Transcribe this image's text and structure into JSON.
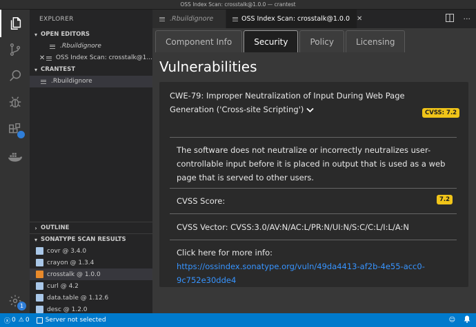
{
  "window": {
    "title": "OSS Index Scan: crosstalk@1.0.0 — crantest"
  },
  "colors": {
    "accent": "#007acc",
    "cvss_badge": "#f0c419",
    "link": "#3794ff",
    "r_package": "#a9c7e8",
    "selected_package": "#e8892b"
  },
  "activity_bar": {
    "icons": [
      "files-icon",
      "source-control-icon",
      "search-icon",
      "debug-icon",
      "extensions-icon",
      "docker-icon",
      "gear-icon"
    ],
    "extensions_badge": "",
    "settings_badge": "1"
  },
  "sidebar": {
    "title": "EXPLORER",
    "open_editors": {
      "label": "OPEN EDITORS",
      "items": [
        ".Rbuildignore",
        "OSS Index Scan: crosstalk@1..."
      ]
    },
    "folder": {
      "label": "CRANTEST",
      "items": [
        ".Rbuildignore"
      ]
    },
    "outline_label": "OUTLINE",
    "sonatype": {
      "label": "SONATYPE SCAN RESULTS",
      "packages": [
        "covr @ 3.4.0",
        "crayon @ 1.3.4",
        "crosstalk @ 1.0.0",
        "curl @ 4.2",
        "data.table @ 1.12.6",
        "desc @ 1.2.0"
      ]
    }
  },
  "editor": {
    "tabs": [
      ".Rbuildignore",
      "OSS Index Scan: crosstalk@1.0.0"
    ],
    "close_glyph": "✕",
    "subtabs": [
      "Component Info",
      "Security",
      "Policy",
      "Licensing"
    ],
    "heading": "Vulnerabilities",
    "vulnerability": {
      "title": "CWE-79: Improper Neutralization of Input During Web Page Generation ('Cross-site Scripting')",
      "badge": "CVSS: 7.2",
      "description": "The software does not neutralize or incorrectly neutralizes user-controllable input before it is placed in output that is used as a web page that is served to other users.",
      "score_label": "CVSS Score:",
      "score_value": "7.2",
      "vector": "CVSS Vector: CVSS:3.0/AV:N/AC:L/PR:N/UI:N/S:C/C:L/I:L/A:N",
      "more_info_prefix": "Click here for more info: ",
      "more_info_url": "https://ossindex.sonatype.org/vuln/49da4413-af2b-4e55-acc0-9c752e30dde4"
    }
  },
  "status_bar": {
    "errors": "0",
    "warnings": "0",
    "server_status": "Server not selected"
  }
}
